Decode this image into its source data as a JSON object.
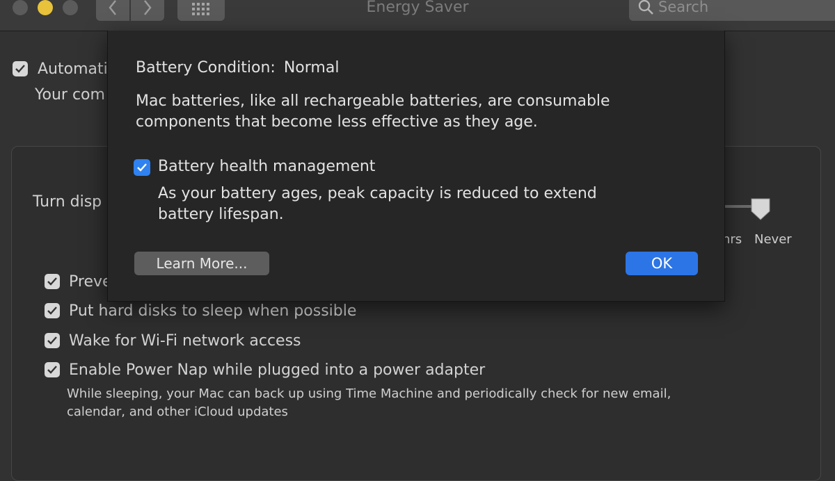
{
  "window": {
    "title": "Energy Saver",
    "search_placeholder": "Search",
    "back_icon": "chevron-left-icon",
    "forward_icon": "chevron-right-icon",
    "grid_icon": "grid-icon"
  },
  "background": {
    "auto_label": "Automati",
    "auto_sub": "Your com",
    "turn_display_label": "Turn disp",
    "slider_tick_hrs": "hrs",
    "slider_tick_never": "Never",
    "options": [
      {
        "label": "Preve",
        "checked": true
      },
      {
        "label": "Put hard disks to sleep when possible",
        "checked": true
      },
      {
        "label": "Wake for Wi-Fi network access",
        "checked": true
      },
      {
        "label": "Enable Power Nap while plugged into a power adapter",
        "checked": true
      }
    ],
    "power_nap_desc_line1": "While sleeping, your Mac can back up using Time Machine and periodically check for new email,",
    "power_nap_desc_line2": "calendar, and other iCloud updates"
  },
  "dialog": {
    "condition_label": "Battery Condition:",
    "condition_value": "Normal",
    "description": "Mac batteries, like all rechargeable batteries, are consumable components that become less effective as they age.",
    "health_management_label": "Battery health management",
    "health_management_checked": true,
    "health_management_desc": "As your battery ages, peak capacity is reduced to extend battery lifespan.",
    "learn_more_label": "Learn More...",
    "ok_label": "OK"
  },
  "colors": {
    "accent": "#2c75e6",
    "minimize_light": "#e7c23a",
    "background": "#323232"
  }
}
